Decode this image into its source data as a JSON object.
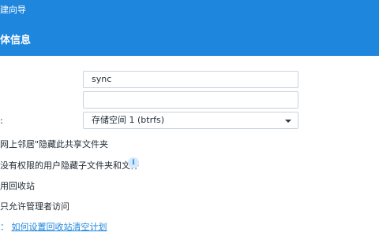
{
  "header": {
    "wizard_title": "建向导",
    "section_title": "体信息"
  },
  "form": {
    "name_value": "sync",
    "description_value": "",
    "location_label": ":",
    "location_value": "存储空间 1 (btrfs)",
    "options": [
      "网上邻居\"隐藏此共享文件夹",
      "没有权限的用户隐藏子文件夹和文件",
      "用回收站",
      "只允许管理者访问"
    ],
    "recycle_prefix": "：",
    "recycle_link": "如何设置回收站清空计划"
  },
  "colors": {
    "header_bg": "#1e86dd",
    "accent": "#1e86dd",
    "field_border": "#c9d2db"
  },
  "icons": {
    "info": "info-icon",
    "dropdown": "chevron-down-icon"
  }
}
